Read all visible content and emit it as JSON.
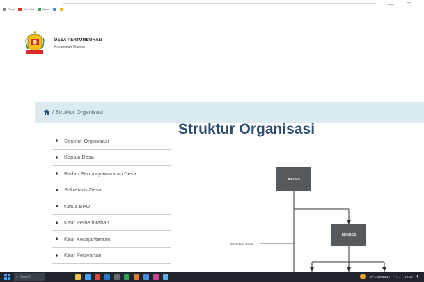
{
  "bookmarks": [
    {
      "label": "Gmail",
      "color": "#888888"
    },
    {
      "label": "YouTube",
      "color": "#d93025"
    },
    {
      "label": "Maps",
      "color": "#34a853"
    },
    {
      "label": "",
      "color": "#4285f4"
    },
    {
      "label": "",
      "color": "#fbbc05"
    }
  ],
  "header": {
    "name": "DESA PERTUMBUHAN",
    "subtitle": "Kecamatan Wampu"
  },
  "breadcrumb": {
    "text": "/ Struktur Organisasi"
  },
  "sidebar": {
    "items": [
      {
        "label": "Struktur Organisasi"
      },
      {
        "label": "Kepala Desa"
      },
      {
        "label": "Badan Permusyawaratan Desa"
      },
      {
        "label": "Sekretaris Desa"
      },
      {
        "label": "Ketua BPD"
      },
      {
        "label": "Kaur Pemerintahan"
      },
      {
        "label": "Kaur Kesejahteraan"
      },
      {
        "label": "Kaur Pelayanan"
      }
    ]
  },
  "main": {
    "title": "Struktur Organisasi"
  },
  "org_chart": {
    "kades": "KADES",
    "sekdes": "SEKDES",
    "sekdes_side_label": "Sekretaris Desa"
  },
  "taskbar": {
    "search_placeholder": "Search",
    "tray_text": "29°C Berawan",
    "time": "12:08"
  },
  "colors": {
    "title": "#2c4d72",
    "crumb_bg": "#dcebf0",
    "box": "#555a5e",
    "taskbar": "#20252b"
  }
}
